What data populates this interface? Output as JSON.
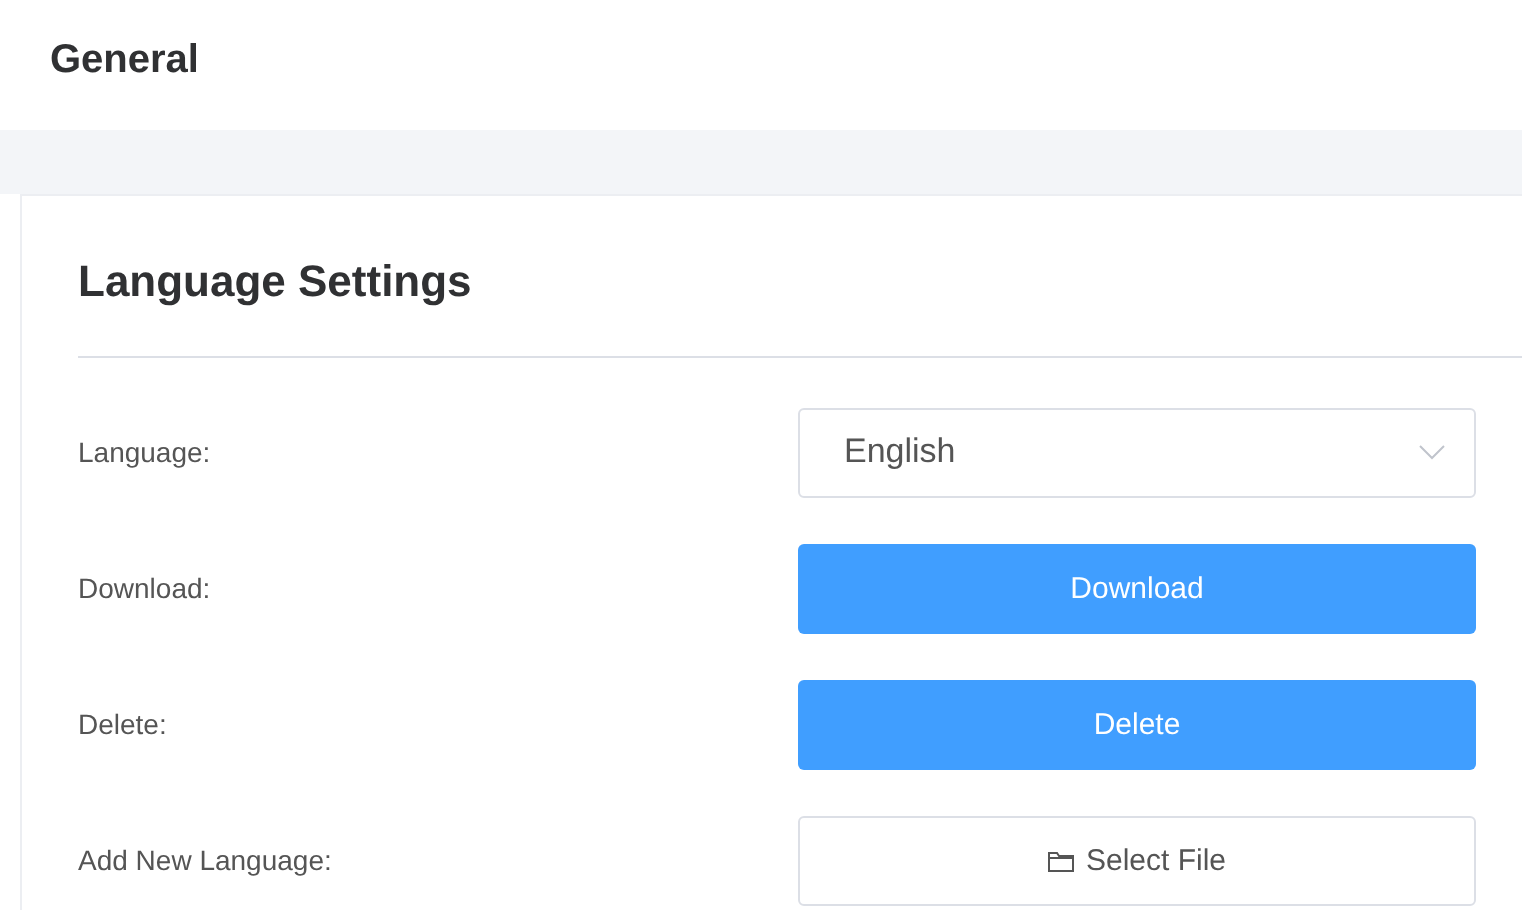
{
  "page_title": "General",
  "card": {
    "title": "Language Settings",
    "rows": [
      {
        "label": "Language:",
        "kind": "select",
        "value": "English"
      },
      {
        "label": "Download:",
        "kind": "primary",
        "text": "Download"
      },
      {
        "label": "Delete:",
        "kind": "primary",
        "text": "Delete"
      },
      {
        "label": "Add New Language:",
        "kind": "file",
        "text": "Select File"
      }
    ]
  }
}
